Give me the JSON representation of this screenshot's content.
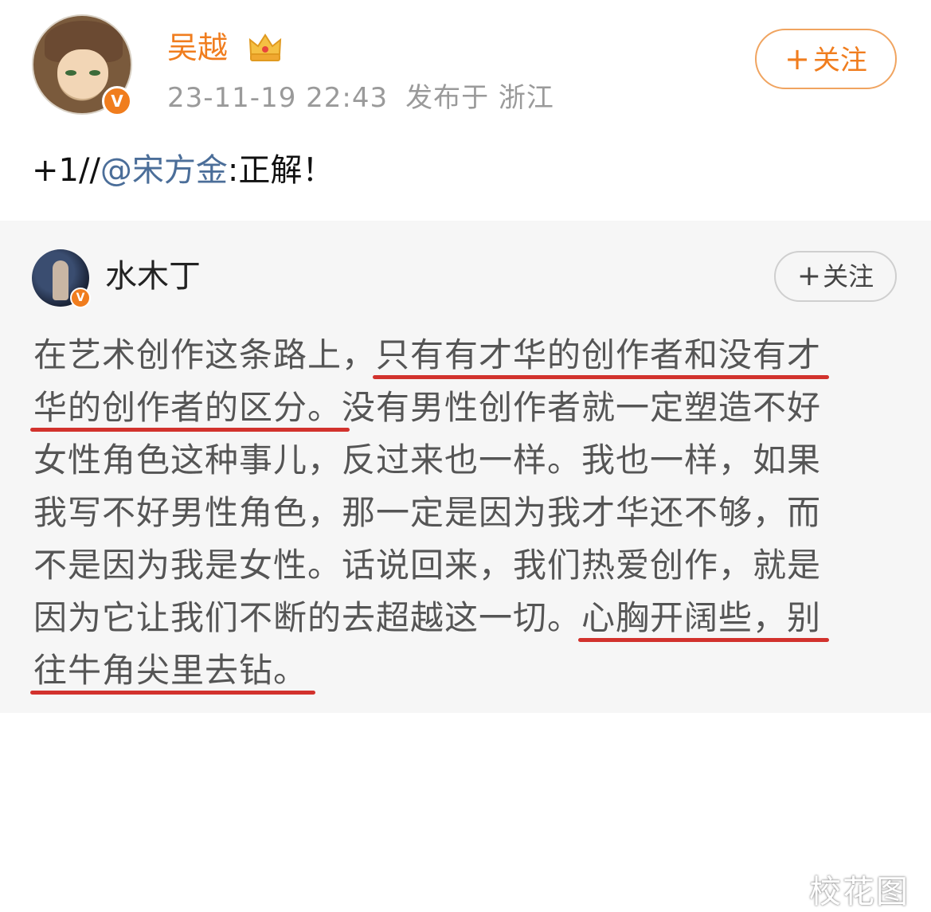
{
  "main_post": {
    "username": "吴越",
    "timestamp": "23-11-19 22:43",
    "location": "发布于 浙江",
    "follow_label": "关注",
    "text_prefix": "+1//",
    "mention": "@宋方金",
    "text_suffix": ":正解！",
    "verified_icon": "verified-v-icon",
    "crown_icon": "crown-icon",
    "accent_color": "#f07d1e"
  },
  "quoted_post": {
    "username": "水木丁",
    "follow_label": "关注",
    "lines": [
      {
        "pre": "在艺术创作这条路上，",
        "hl": "只有有才华的创作者和没有才",
        "post": ""
      },
      {
        "pre": "",
        "hl": "华的创作者的区分。",
        "post": "没有男性创作者就一定塑造不好"
      },
      {
        "pre": "女性角色这种事儿，反过来也一样。我也一样，如果",
        "hl": "",
        "post": ""
      },
      {
        "pre": "我写不好男性角色，那一定是因为我才华还不够，而",
        "hl": "",
        "post": ""
      },
      {
        "pre": "不是因为我是女性。话说回来，我们热爱创作，就是",
        "hl": "",
        "post": ""
      },
      {
        "pre": "因为它让我们不断的去超越这一切。",
        "hl": "心胸开阔些，别",
        "post": ""
      },
      {
        "pre": "",
        "hl": "往牛角尖里去钻。",
        "post": ""
      }
    ],
    "highlight_color": "#d2322d"
  },
  "watermark": "校花图"
}
